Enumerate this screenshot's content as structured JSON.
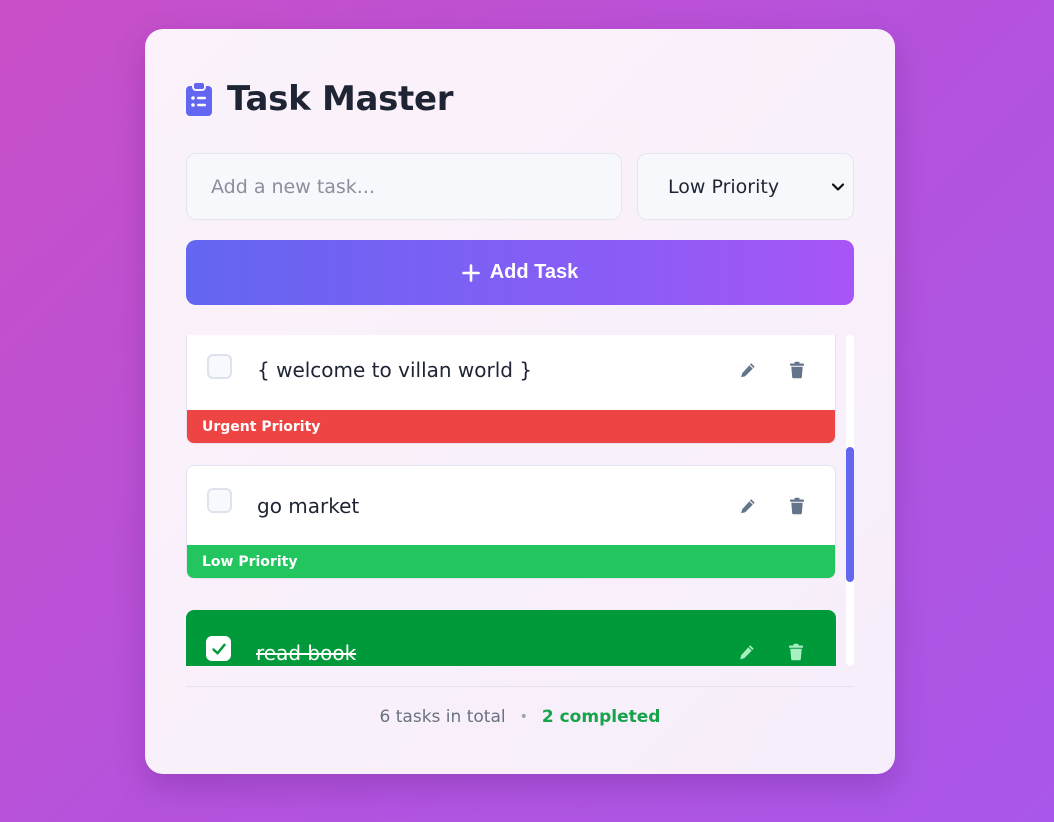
{
  "app": {
    "title": "Task Master",
    "icon": "clipboard-list-icon"
  },
  "new_task": {
    "placeholder": "Add a new task...",
    "value": ""
  },
  "priority_select": {
    "selected": "Low Priority"
  },
  "add_button": {
    "label": "Add Task"
  },
  "tasks": [
    {
      "text": "{ welcome to villan world }",
      "priority": "Urgent Priority",
      "completed": false
    },
    {
      "text": "go market",
      "priority": "Low Priority",
      "completed": false
    },
    {
      "text": "read book",
      "priority": "",
      "completed": true
    }
  ],
  "footer": {
    "total": "6 tasks in total",
    "separator": "•",
    "completed": "2 completed"
  },
  "colors": {
    "accent": "#6366f1",
    "urgent": "#ef4444",
    "low": "#22c55e",
    "completed_task": "#009a3a"
  }
}
